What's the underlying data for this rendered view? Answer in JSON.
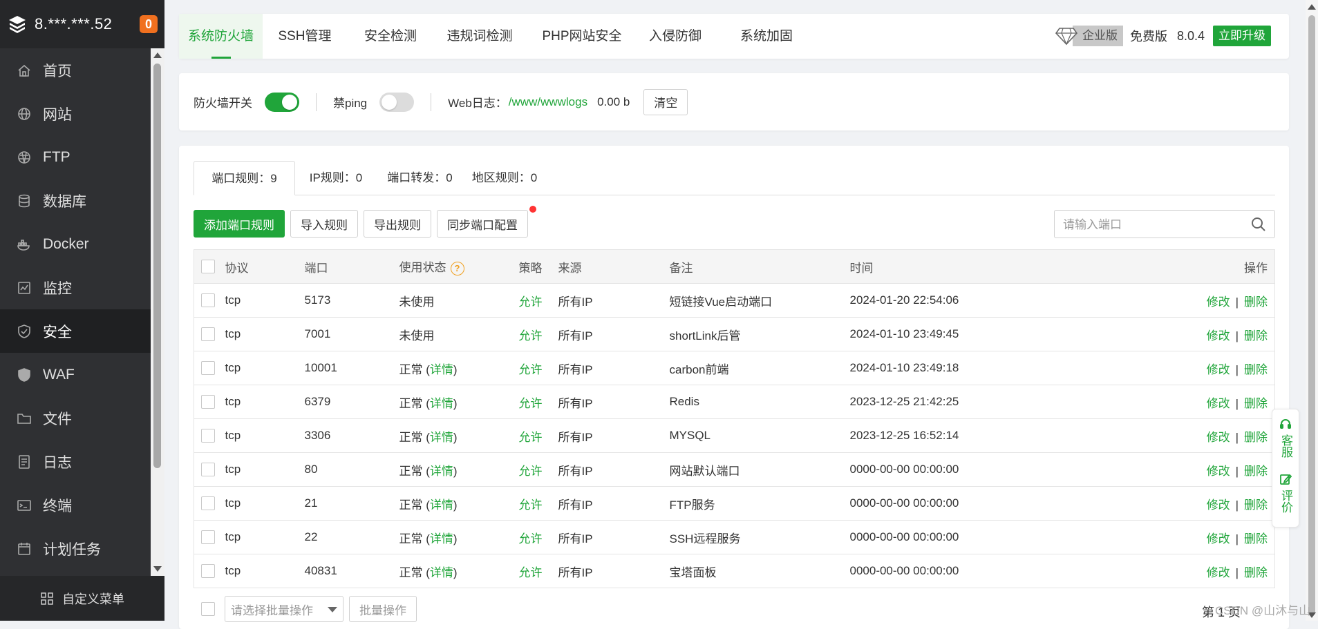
{
  "server": {
    "ip": "8.***.***.52",
    "badge": "0"
  },
  "sidebar": {
    "items": [
      {
        "label": "首页",
        "icon": "home-icon"
      },
      {
        "label": "网站",
        "icon": "globe-icon"
      },
      {
        "label": "FTP",
        "icon": "ftp-icon"
      },
      {
        "label": "数据库",
        "icon": "database-icon"
      },
      {
        "label": "Docker",
        "icon": "docker-icon"
      },
      {
        "label": "监控",
        "icon": "monitor-icon"
      },
      {
        "label": "安全",
        "icon": "shield-icon",
        "active": true
      },
      {
        "label": "WAF",
        "icon": "waf-shield-icon"
      },
      {
        "label": "文件",
        "icon": "folder-icon"
      },
      {
        "label": "日志",
        "icon": "log-icon"
      },
      {
        "label": "终端",
        "icon": "terminal-icon"
      },
      {
        "label": "计划任务",
        "icon": "calendar-icon"
      }
    ],
    "footer": "自定义菜单"
  },
  "topnav": {
    "tabs": [
      "系统防火墙",
      "SSH管理",
      "安全检测",
      "违规词检测",
      "PHP网站安全",
      "入侵防御",
      "系统加固"
    ],
    "active": 0,
    "enterprise": "企业版",
    "free": "免费版",
    "version": "8.0.4",
    "upgrade": "立即升级"
  },
  "switches": {
    "firewall_label": "防火墙开关",
    "firewall_on": true,
    "ping_label": "禁ping",
    "ping_on": false,
    "weblog_label": "Web日志：",
    "weblog_path": "/www/wwwlogs",
    "weblog_size": "0.00 b",
    "clear": "清空"
  },
  "subtabs": [
    "端口规则：9",
    "IP规则：0",
    "端口转发：0",
    "地区规则：0"
  ],
  "toolbar": {
    "add": "添加端口规则",
    "import": "导入规则",
    "export": "导出规则",
    "sync": "同步端口配置",
    "search_placeholder": "请输入端口"
  },
  "table": {
    "headers": [
      "协议",
      "端口",
      "使用状态",
      "策略",
      "来源",
      "备注",
      "时间",
      "操作"
    ],
    "help_mark": "?",
    "rows": [
      {
        "proto": "tcp",
        "port": "5173",
        "status": "未使用",
        "detail": "",
        "policy": "允许",
        "source": "所有IP",
        "note": "短链接Vue启动端口",
        "time": "2024-01-20 22:54:06"
      },
      {
        "proto": "tcp",
        "port": "7001",
        "status": "未使用",
        "detail": "",
        "policy": "允许",
        "source": "所有IP",
        "note": "shortLink后管",
        "time": "2024-01-10 23:49:45"
      },
      {
        "proto": "tcp",
        "port": "10001",
        "status": "正常",
        "detail": "详情",
        "policy": "允许",
        "source": "所有IP",
        "note": "carbon前端",
        "time": "2024-01-10 23:49:18"
      },
      {
        "proto": "tcp",
        "port": "6379",
        "status": "正常",
        "detail": "详情",
        "policy": "允许",
        "source": "所有IP",
        "note": "Redis",
        "time": "2023-12-25 21:42:25"
      },
      {
        "proto": "tcp",
        "port": "3306",
        "status": "正常",
        "detail": "详情",
        "policy": "允许",
        "source": "所有IP",
        "note": "MYSQL",
        "time": "2023-12-25 16:52:14"
      },
      {
        "proto": "tcp",
        "port": "80",
        "status": "正常",
        "detail": "详情",
        "policy": "允许",
        "source": "所有IP",
        "note": "网站默认端口",
        "time": "0000-00-00 00:00:00"
      },
      {
        "proto": "tcp",
        "port": "21",
        "status": "正常",
        "detail": "详情",
        "policy": "允许",
        "source": "所有IP",
        "note": "FTP服务",
        "time": "0000-00-00 00:00:00"
      },
      {
        "proto": "tcp",
        "port": "22",
        "status": "正常",
        "detail": "详情",
        "policy": "允许",
        "source": "所有IP",
        "note": "SSH远程服务",
        "time": "0000-00-00 00:00:00"
      },
      {
        "proto": "tcp",
        "port": "40831",
        "status": "正常",
        "detail": "详情",
        "policy": "允许",
        "source": "所有IP",
        "note": "宝塔面板",
        "time": "0000-00-00 00:00:00"
      }
    ],
    "edit": "修改",
    "delete": "删除",
    "op_sep": "|"
  },
  "bottom": {
    "batch_placeholder": "请选择批量操作",
    "batch_button": "批量操作",
    "page": "第 1 页"
  },
  "float": {
    "service": "客服",
    "review": "评价"
  },
  "watermark": "CSDN @山沐与山",
  "colors": {
    "accent": "#20a53a",
    "sidebar": "#2f3033",
    "badge": "#f0701f"
  }
}
